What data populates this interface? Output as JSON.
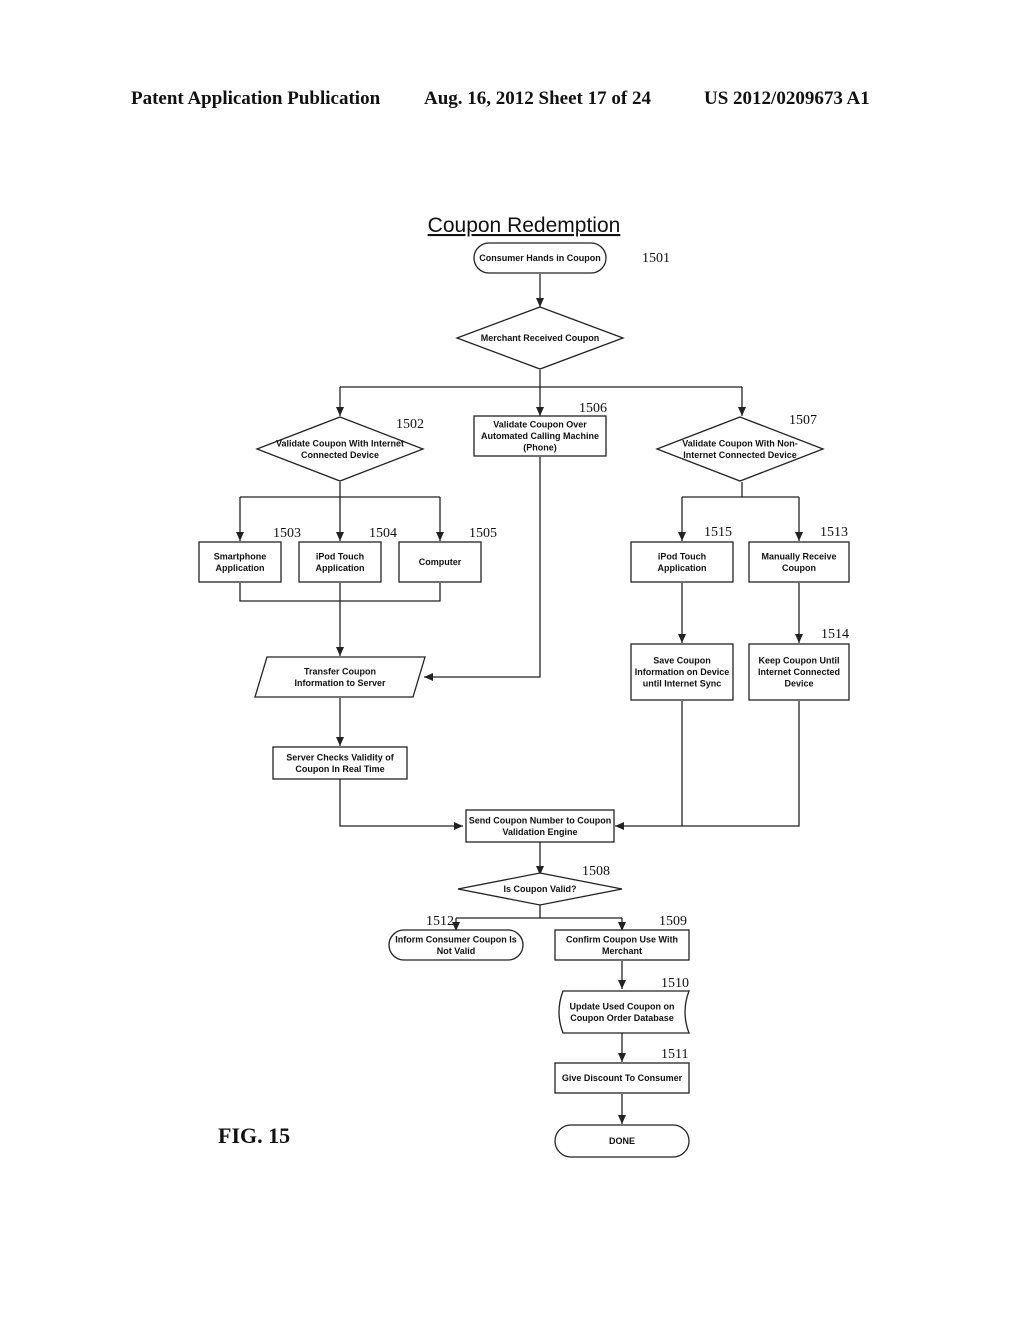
{
  "header": {
    "publication": "Patent Application Publication",
    "date_sheet": "Aug. 16, 2012  Sheet 17 of 24",
    "patent_number": "US 2012/0209673 A1"
  },
  "diagram": {
    "title": "Coupon Redemption",
    "figure_label": "FIG. 15",
    "nodes": {
      "n1501": {
        "ref": "1501",
        "shape": "terminator",
        "lines": [
          "Consumer Hands in Coupon"
        ]
      },
      "merchant": {
        "ref": "",
        "shape": "decision",
        "lines": [
          "Merchant Received Coupon"
        ]
      },
      "n1502": {
        "ref": "1502",
        "shape": "decision",
        "lines": [
          "Validate Coupon With Internet",
          "Connected Device"
        ]
      },
      "n1506": {
        "ref": "1506",
        "shape": "process",
        "lines": [
          "Validate Coupon Over",
          "Automated Calling Machine",
          "(Phone)"
        ]
      },
      "n1507": {
        "ref": "1507",
        "shape": "decision",
        "lines": [
          "Validate Coupon With Non-",
          "Internet Connected Device"
        ]
      },
      "n1503": {
        "ref": "1503",
        "shape": "process",
        "lines": [
          "Smartphone",
          "Application"
        ]
      },
      "n1504": {
        "ref": "1504",
        "shape": "process",
        "lines": [
          "iPod Touch",
          "Application"
        ]
      },
      "n1505": {
        "ref": "1505",
        "shape": "process",
        "lines": [
          "Computer"
        ]
      },
      "n1515": {
        "ref": "1515",
        "shape": "process",
        "lines": [
          "iPod Touch",
          "Application"
        ]
      },
      "n1513": {
        "ref": "1513",
        "shape": "process",
        "lines": [
          "Manually Receive",
          "Coupon"
        ]
      },
      "transfer": {
        "ref": "",
        "shape": "data",
        "lines": [
          "Transfer Coupon",
          "Information to Server"
        ]
      },
      "save": {
        "ref": "",
        "shape": "process",
        "lines": [
          "Save Coupon",
          "Information on Device",
          "until Internet Sync"
        ]
      },
      "n1514": {
        "ref": "1514",
        "shape": "process",
        "lines": [
          "Keep Coupon Until",
          "Internet Connected",
          "Device"
        ]
      },
      "server": {
        "ref": "",
        "shape": "process",
        "lines": [
          "Server Checks Validity of",
          "Coupon In Real Time"
        ]
      },
      "send": {
        "ref": "",
        "shape": "process",
        "lines": [
          "Send Coupon Number to Coupon",
          "Validation Engine"
        ]
      },
      "n1508": {
        "ref": "1508",
        "shape": "decision",
        "lines": [
          "Is Coupon Valid?"
        ]
      },
      "n1512": {
        "ref": "1512",
        "shape": "terminator",
        "lines": [
          "Inform Consumer Coupon Is",
          "Not Valid"
        ]
      },
      "n1509": {
        "ref": "1509",
        "shape": "process",
        "lines": [
          "Confirm Coupon Use With",
          "Merchant"
        ]
      },
      "n1510": {
        "ref": "1510",
        "shape": "document",
        "lines": [
          "Update Used Coupon on",
          "Coupon Order Database"
        ]
      },
      "n1511": {
        "ref": "1511",
        "shape": "process",
        "lines": [
          "Give Discount To Consumer"
        ]
      },
      "done": {
        "ref": "",
        "shape": "terminator",
        "lines": [
          "DONE"
        ]
      }
    },
    "edges": [
      [
        "n1501",
        "merchant"
      ],
      [
        "merchant",
        "n1502"
      ],
      [
        "merchant",
        "n1506"
      ],
      [
        "merchant",
        "n1507"
      ],
      [
        "n1502",
        "n1503"
      ],
      [
        "n1502",
        "n1504"
      ],
      [
        "n1502",
        "n1505"
      ],
      [
        "n1503",
        "transfer"
      ],
      [
        "n1504",
        "transfer"
      ],
      [
        "n1505",
        "transfer"
      ],
      [
        "n1506",
        "transfer"
      ],
      [
        "n1507",
        "n1515"
      ],
      [
        "n1507",
        "n1513"
      ],
      [
        "n1515",
        "save"
      ],
      [
        "n1513",
        "n1514"
      ],
      [
        "transfer",
        "server"
      ],
      [
        "server",
        "send"
      ],
      [
        "save",
        "send"
      ],
      [
        "n1514",
        "send"
      ],
      [
        "send",
        "n1508"
      ],
      [
        "n1508",
        "n1512"
      ],
      [
        "n1508",
        "n1509"
      ],
      [
        "n1509",
        "n1510"
      ],
      [
        "n1510",
        "n1511"
      ],
      [
        "n1511",
        "done"
      ]
    ]
  }
}
